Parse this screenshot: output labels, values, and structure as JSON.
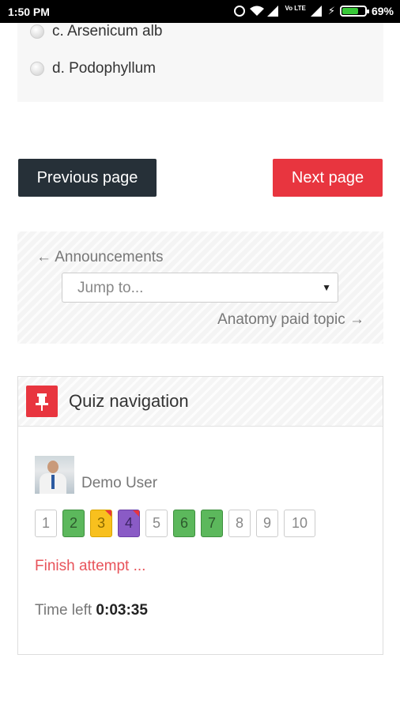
{
  "status_bar": {
    "time": "1:50 PM",
    "battery": "69%",
    "volte": "Vo LTE",
    "icons": [
      "alarm-icon",
      "wifi-icon",
      "signal-icon",
      "volte-icon",
      "signal-icon",
      "charging-icon",
      "battery-icon"
    ]
  },
  "answers": {
    "options": [
      {
        "label": "c. Arsenicum alb"
      },
      {
        "label": "d. Podophyllum"
      }
    ]
  },
  "page_nav": {
    "previous_label": "Previous page",
    "next_label": "Next page"
  },
  "activity_nav": {
    "previous_link": "← Announcements",
    "jump_placeholder": "Jump to...",
    "next_link": "Anatomy paid topic →"
  },
  "quiz_nav": {
    "title": "Quiz navigation",
    "user_name": "Demo User",
    "questions": [
      {
        "label": "1",
        "state": "notyetanswered"
      },
      {
        "label": "2",
        "state": "correct"
      },
      {
        "label": "3",
        "state": "partiallycorrect",
        "flagged": true
      },
      {
        "label": "4",
        "state": "answered",
        "flagged": true
      },
      {
        "label": "5",
        "state": "notyetanswered"
      },
      {
        "label": "6",
        "state": "correct"
      },
      {
        "label": "7",
        "state": "correct"
      },
      {
        "label": "8",
        "state": "notyetanswered"
      },
      {
        "label": "9",
        "state": "notyetanswered"
      },
      {
        "label": "10",
        "state": "notyetanswered"
      }
    ],
    "finish_label": "Finish attempt ...",
    "time_left_label": "Time left",
    "time_left_value": "0:03:35"
  },
  "colors": {
    "accent_red": "#e8353f",
    "dark_button": "#263038",
    "correct_green": "#5cb85c",
    "partial_yellow": "#f8c01e",
    "answered_purple": "#8a5bc6"
  }
}
